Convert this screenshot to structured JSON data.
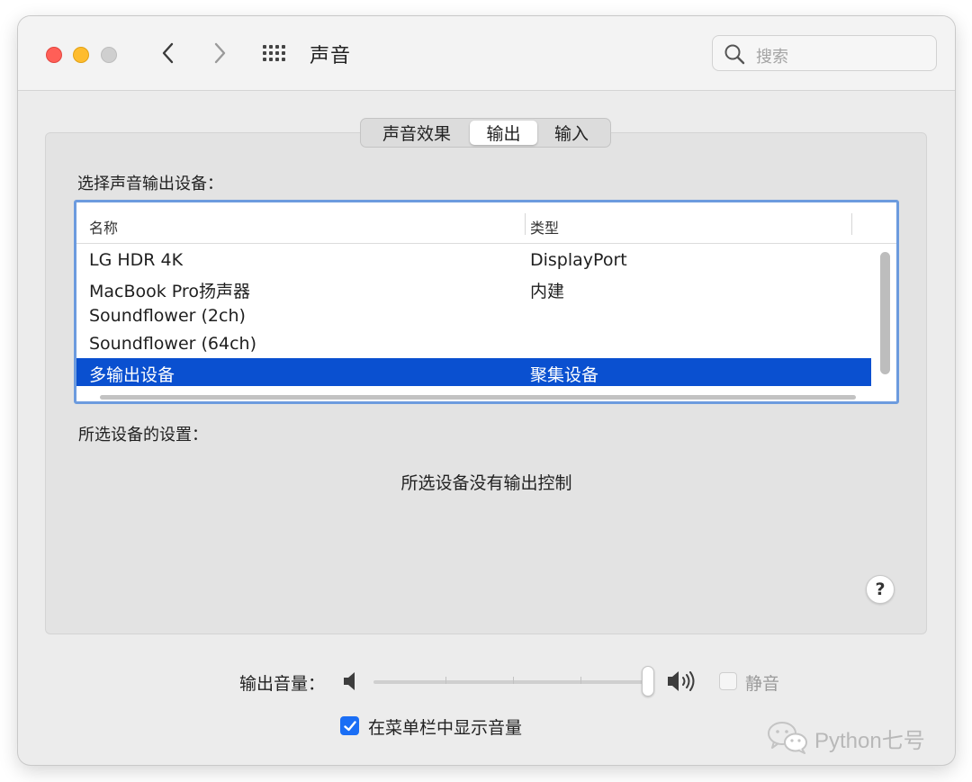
{
  "window": {
    "title": "声音",
    "search_placeholder": "搜索"
  },
  "tabs": [
    {
      "label": "声音效果",
      "selected": false
    },
    {
      "label": "输出",
      "selected": true
    },
    {
      "label": "输入",
      "selected": false
    }
  ],
  "output": {
    "select_label": "选择声音输出设备：",
    "columns": [
      "名称",
      "类型"
    ],
    "devices": [
      {
        "name": "LG HDR 4K",
        "type": "DisplayPort"
      },
      {
        "name": "MacBook Pro扬声器",
        "type": "内建"
      },
      {
        "name": "Soundflower (2ch)",
        "type": ""
      },
      {
        "name": "Soundflower (64ch)",
        "type": ""
      },
      {
        "name": "多输出设备",
        "type": "聚集设备",
        "selected": true
      }
    ],
    "settings_label": "所选设备的设置：",
    "no_control_text": "所选设备没有输出控制"
  },
  "help_label": "?",
  "volume": {
    "label": "输出音量：",
    "level": 1.0,
    "mute_label": "静音",
    "mute_checked": false,
    "mute_enabled": false
  },
  "menu_bar": {
    "label": "在菜单栏中显示音量",
    "checked": true
  },
  "watermark": {
    "text": "Python七号"
  },
  "colors": {
    "selection": "#0a50d0",
    "focus_ring": "#6c9bde",
    "checkbox": "#1a6ef5",
    "close": "#ff5f57",
    "minimize": "#febc2e"
  }
}
